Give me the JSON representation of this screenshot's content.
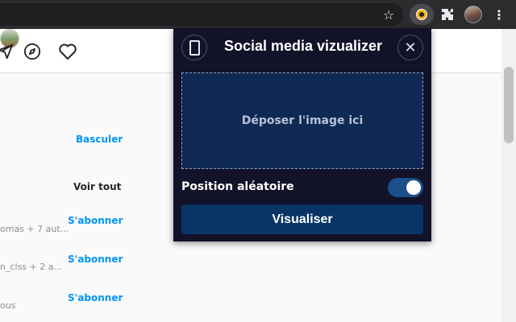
{
  "browser": {
    "icons": [
      "star-icon",
      "extension-eye-icon",
      "puzzle-icon",
      "avatar",
      "menu-dots-icon"
    ]
  },
  "page": {
    "nav_icons": [
      "send-icon",
      "compass-icon",
      "heart-icon",
      "profile-avatar"
    ],
    "switch_label": "Basculer",
    "see_all_label": "Voir tout",
    "suggestions": [
      {
        "text": "omas + 7 aut...",
        "follow_label": "S'abonner"
      },
      {
        "text": "n_clss + 2 a...",
        "follow_label": "S'abonner"
      },
      {
        "text": "ous",
        "follow_label": "S'abonner"
      }
    ],
    "colors": {
      "link": "#0095f6",
      "muted": "#8e8e8e"
    }
  },
  "popup": {
    "title": "Social media vizualizer",
    "dropzone_label": "Déposer l'image ici",
    "toggle_label": "Position aléatoire",
    "toggle_on": true,
    "button_label": "Visualiser",
    "colors": {
      "background": "#121229",
      "dropzone": "#0e2a54",
      "button": "#083566",
      "toggle": "#1b4e8b"
    }
  }
}
